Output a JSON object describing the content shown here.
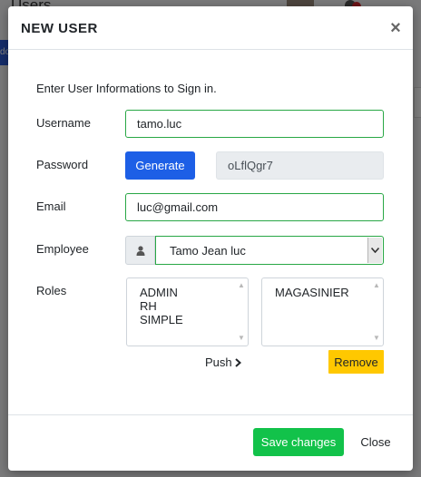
{
  "background": {
    "title": "Users",
    "tab_label": "do"
  },
  "modal": {
    "title": "NEW USER",
    "close_glyph": "×",
    "intro": "Enter User Informations to Sign in.",
    "username": {
      "label": "Username",
      "value": "tamo.luc"
    },
    "password": {
      "label": "Password",
      "generate_label": "Generate",
      "value": "oLflQgr7"
    },
    "email": {
      "label": "Email",
      "value": "luc@gmail.com"
    },
    "employee": {
      "label": "Employee",
      "selected": "Tamo Jean luc",
      "prefix_icon": "user-icon"
    },
    "roles": {
      "label": "Roles",
      "available": [
        "ADMIN",
        "RH",
        "SIMPLE"
      ],
      "assigned": [
        "MAGASINIER"
      ],
      "push_label": "Push",
      "remove_label": "Remove"
    },
    "footer": {
      "save_label": "Save changes",
      "close_label": "Close"
    }
  },
  "colors": {
    "primary": "#1d5fe6",
    "success": "#12c24a",
    "success_border": "#28a745",
    "warning": "#ffc800"
  }
}
